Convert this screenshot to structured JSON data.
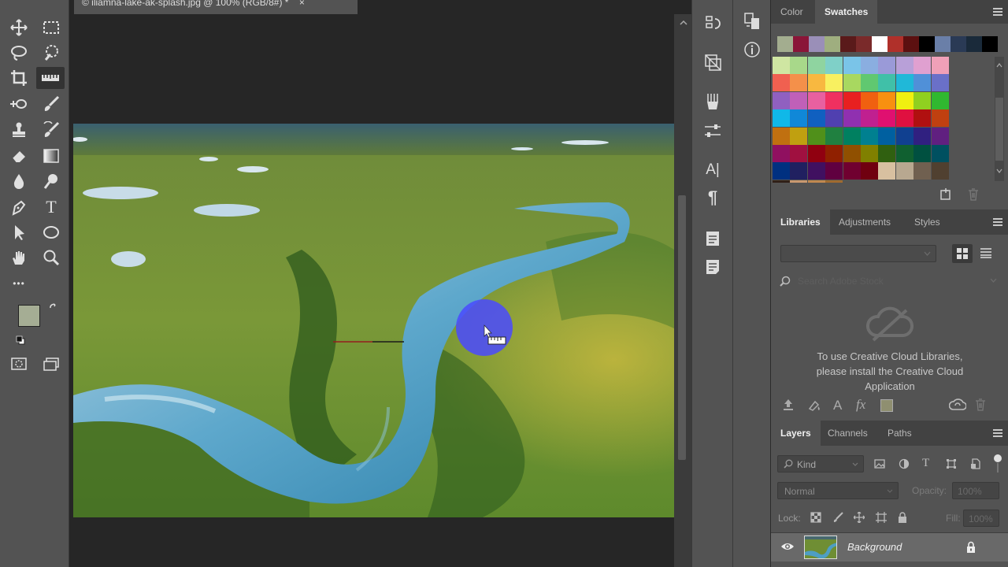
{
  "document": {
    "tab_title": "© iliamna-lake-ak-splash.jpg @ 100% (RGB/8#) *",
    "close_glyph": "×"
  },
  "toolbar": {
    "tools": [
      "move-tool",
      "marquee-tool",
      "lasso-tool",
      "quick-select-tool",
      "crop-tool",
      "ruler-tool",
      "spot-heal-tool",
      "brush-tool",
      "stamp-tool",
      "history-brush-tool",
      "eraser-tool",
      "gradient-tool",
      "blur-tool",
      "dodge-tool",
      "pen-tool",
      "type-tool",
      "path-select-tool",
      "ellipse-tool",
      "hand-tool",
      "zoom-tool",
      "more-tools"
    ],
    "more_label": "•••",
    "type_glyph": "T",
    "foreground_color": "#a5ad94",
    "background_color": "#ffffff"
  },
  "panel_icons": {
    "char_glyph": "A|",
    "para_glyph": "¶"
  },
  "color_panel": {
    "tabs": [
      "Color",
      "Swatches"
    ],
    "active_tab": "Swatches",
    "recent_swatches": [
      "#a3ad8f",
      "#8a1538",
      "#9a8fb8",
      "#9fae7f",
      "#5a1a1a",
      "#7a2a2a",
      "#ffffff",
      "#b0302a",
      "#5c1010",
      "#000000",
      "#6a7fa8",
      "#2a3a55",
      "#1a2a3a",
      "#000000"
    ],
    "swatch_rows": [
      [
        "#cfe6a2",
        "#a8d88a",
        "#8fd4a0",
        "#7fd0c8",
        "#7ac4e8",
        "#8aaee0",
        "#9a9ad8",
        "#b8a0d8",
        "#e0a0d0",
        "#f0a0b8"
      ],
      [
        "#f06050",
        "#f4904a",
        "#f8b840",
        "#f8f060",
        "#a8d860",
        "#60c870",
        "#40c0a8",
        "#20b8d8",
        "#5090d8",
        "#6a70c8"
      ],
      [
        "#9060c0",
        "#c060b8",
        "#e860a0",
        "#f03060",
        "#e82020",
        "#f06010",
        "#f89010",
        "#f0f010",
        "#90d020",
        "#30b830"
      ],
      [
        "#10b8e8",
        "#1088d8",
        "#1060c0",
        "#5040b0",
        "#9030b0",
        "#c02090",
        "#e01070",
        "#e01040",
        "#b01010",
        "#c04010"
      ],
      [
        "#c07010",
        "#c0a010",
        "#50901a",
        "#208040",
        "#008060",
        "#008090",
        "#0060a0",
        "#104090",
        "#302080",
        "#602080"
      ],
      [
        "#901060",
        "#a01040",
        "#900010",
        "#902000",
        "#905000",
        "#808000",
        "#306010",
        "#106030",
        "#005040",
        "#005060"
      ],
      [
        "#003080",
        "#202060",
        "#401060",
        "#600040",
        "#700030",
        "#700010",
        "#d8c0a0",
        "#b8a890",
        "#706050",
        "#504030"
      ],
      [
        "#302018",
        "#c89870",
        "#c08850",
        "#a06a30"
      ]
    ]
  },
  "libraries_panel": {
    "tabs": [
      "Libraries",
      "Adjustments",
      "Styles"
    ],
    "active_tab": "Libraries",
    "search_placeholder": "Search Adobe Stock",
    "message": "To use Creative Cloud Libraries, please install the Creative Cloud Application",
    "fx_glyph": "fx",
    "char_glyph": "A"
  },
  "layers_panel": {
    "tabs": [
      "Layers",
      "Channels",
      "Paths"
    ],
    "active_tab": "Layers",
    "filter_label": "Kind",
    "blend_mode": "Normal",
    "opacity_label": "Opacity:",
    "opacity_value": "100%",
    "lock_label": "Lock:",
    "fill_label": "Fill:",
    "fill_value": "100%",
    "layers": [
      {
        "name": "Background",
        "visible": true,
        "locked": true
      }
    ]
  }
}
